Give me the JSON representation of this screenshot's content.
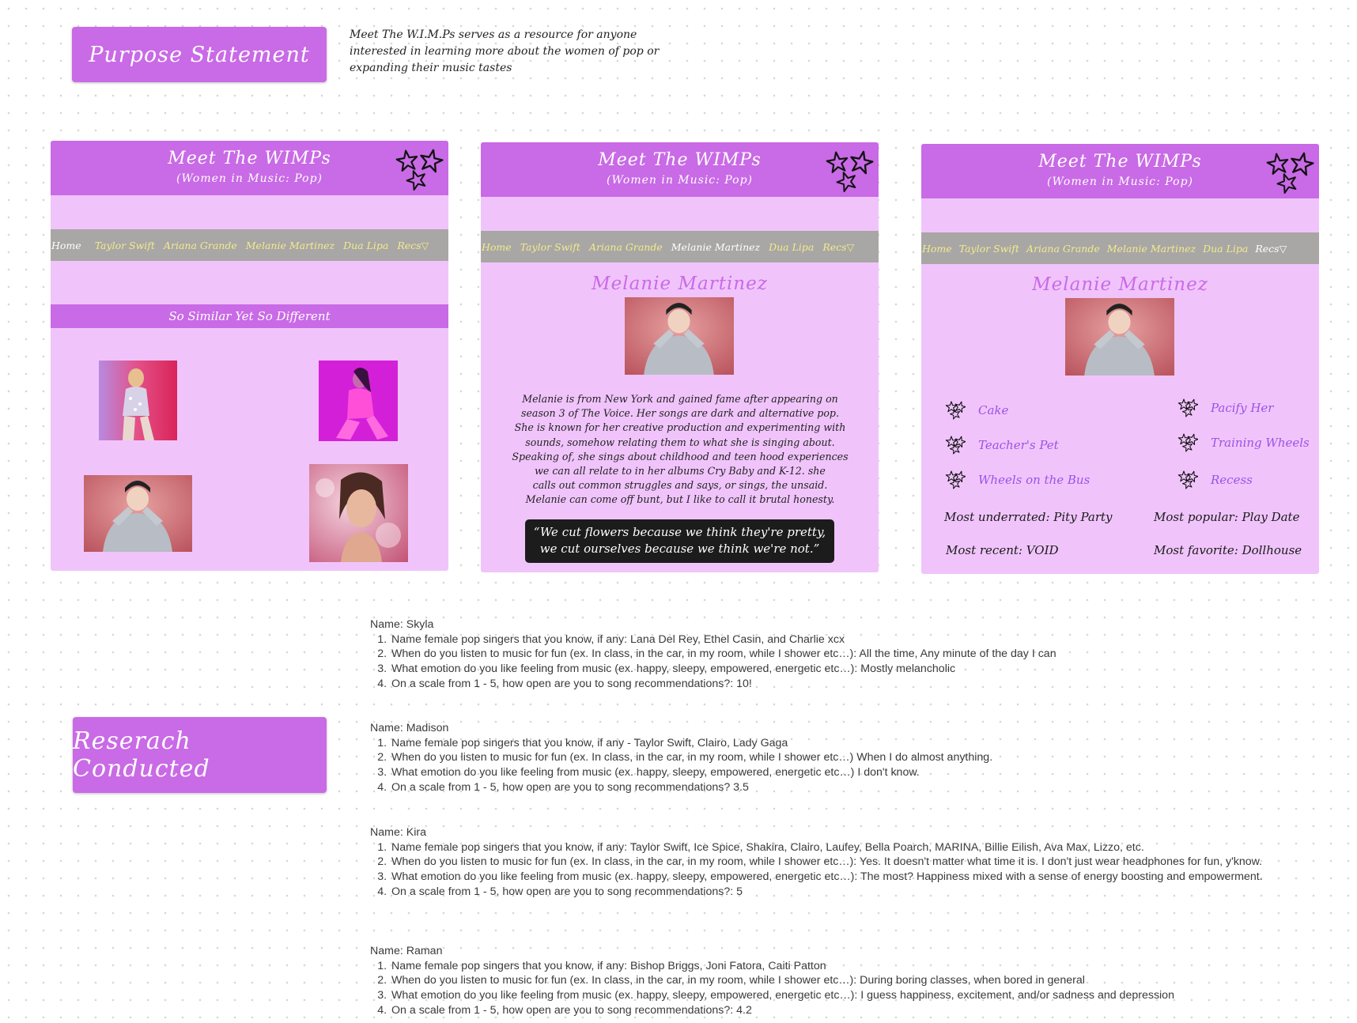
{
  "purpose": {
    "sticker": "Purpose Statement",
    "text": "Meet The W.I.M.Ps serves as a resource for anyone interested in learning more about the women of pop or expanding their music tastes"
  },
  "site": {
    "title": "Meet The WIMPs",
    "subtitle": "(Women in Music: Pop)",
    "logo_icon": "stars-icon",
    "nav": [
      "Home",
      "Taylor Swift",
      "Ariana Grande",
      "Melanie Martinez",
      "Dua Lipa",
      "Recs▽"
    ]
  },
  "home": {
    "section_title": "So Similar Yet So Different"
  },
  "bio": {
    "artist": "Melanie Martinez",
    "text_lines": [
      "Melanie is from New York and gained fame after appearing on",
      "season 3 of The Voice.  Her songs are dark and alternative pop.",
      "She is known for her creative production and experimenting with",
      "sounds, somehow relating them to what she is singing about.",
      "Speaking of, she sings about childhood and teen hood experiences",
      "we can all relate to in her albums Cry Baby and K-12.  she",
      "calls out common struggles and says, or sings, the unsaid.",
      "Melanie can come off bunt, but I like to call it brutal honesty."
    ],
    "quote_lines": [
      "“We cut flowers because we think they're pretty,",
      "we cut ourselves because we think we're not.”"
    ]
  },
  "songs": {
    "artist": "Melanie Martinez",
    "left": [
      "Cake",
      "Teacher's Pet",
      "Wheels on the Bus"
    ],
    "right": [
      "Pacify Her",
      "Training Wheels",
      "Recess"
    ],
    "facts": {
      "underrated": "Most underrated: Pity Party",
      "popular": "Most popular: Play Date",
      "recent": "Most recent: VOID",
      "favorite": "Most favorite: Dollhouse"
    }
  },
  "research": {
    "sticker": "Reserach Conducted",
    "entries": [
      {
        "name": "Name: Skyla",
        "answers": [
          "Name female pop singers that you know, if any: Lana Del Rey, Ethel Casin, and Charlie xcx",
          "When do you listen to music for fun (ex. In class, in the car, in my room, while I shower etc…): All the time, Any minute of the day I can",
          "What emotion do you like feeling from music (ex. happy, sleepy, empowered, energetic etc…): Mostly melancholic",
          "On a scale from 1 - 5, how open are you to song recommendations?: 10!"
        ]
      },
      {
        "name": "Name: Madison",
        "answers": [
          "Name female pop singers that you know, if any - Taylor Swift, Clairo, Lady Gaga",
          "When do you listen to music for fun (ex. In class, in the car, in my room, while I shower etc…) When I do almost anything.",
          "What emotion do you like feeling from music (ex. happy, sleepy, empowered, energetic etc…) I don't know.",
          "On a scale from 1 - 5, how open are you to song recommendations? 3.5"
        ]
      },
      {
        "name": "Name: Kira",
        "answers": [
          "Name female pop singers that you know, if any: Taylor Swift, Ice Spice, Shakira, Clairo, Laufey, Bella Poarch, MARINA, Billie Eilish, Ava Max, Lizzo, etc.",
          "When do you listen to music for fun (ex. In class, in the car, in my room, while I shower etc…): Yes. It doesn't matter what time it is. I don't just wear headphones for fun, y'know.",
          "What emotion do you like feeling from music (ex. happy, sleepy, empowered, energetic etc…): The most? Happiness mixed with a sense of energy boosting and empowerment.",
          "On a scale from 1 - 5, how open are you to song recommendations?: 5"
        ]
      },
      {
        "name": "Name: Raman",
        "answers": [
          "Name female pop singers that you know, if any: Bishop Briggs, Joni Fatora, Caiti Patton",
          "When do you listen to music for fun (ex. In class, in the car, in my room, while I shower etc…): During boring classes, when bored in general",
          "What emotion do you like feeling from music (ex. happy, sleepy, empowered, energetic etc…): I guess happiness, excitement, and/or sadness and depression",
          "On a scale from 1 - 5, how open are you to song recommendations?: 4.2"
        ]
      }
    ]
  }
}
